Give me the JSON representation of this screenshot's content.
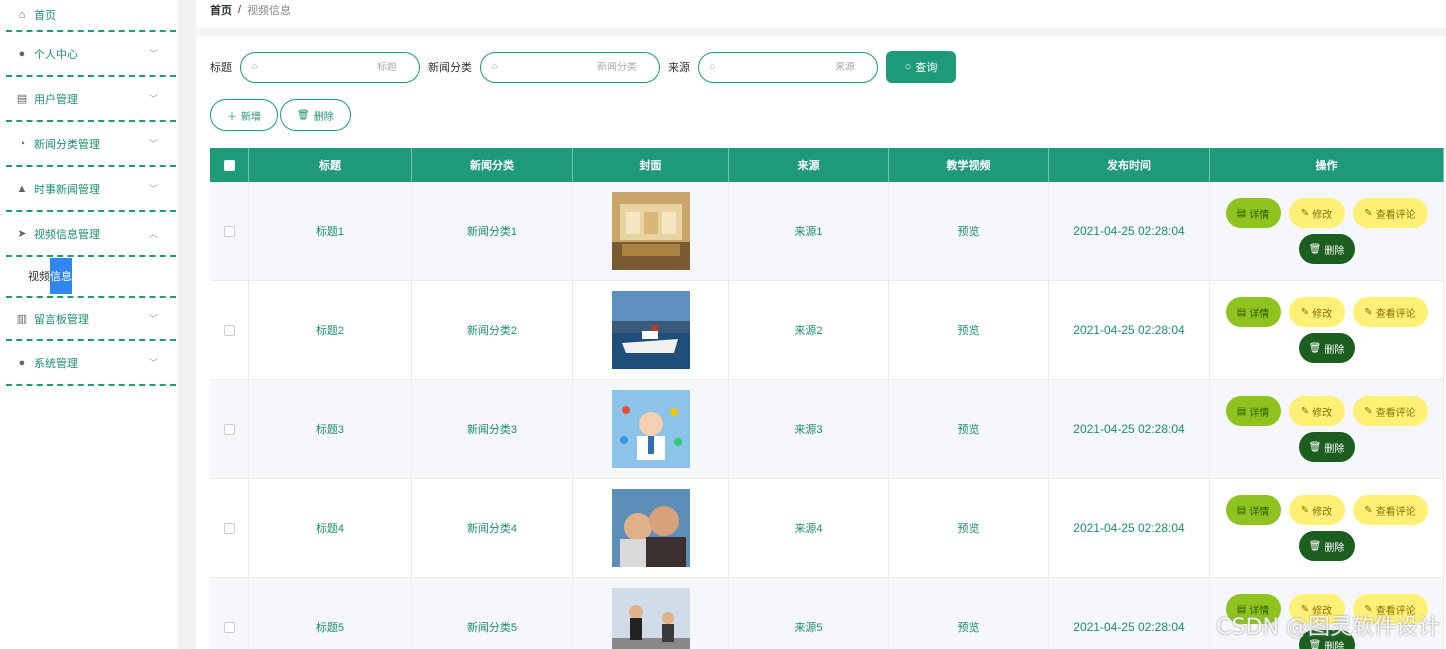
{
  "sidebar": {
    "items": [
      {
        "label": "首页",
        "icon": "home-icon"
      },
      {
        "label": "个人中心",
        "icon": "person-icon"
      },
      {
        "label": "用户管理",
        "icon": "clipboard-icon"
      },
      {
        "label": "新闻分类管理",
        "icon": "gauge-icon"
      },
      {
        "label": "时事新闻管理",
        "icon": "thumbs-up-icon"
      },
      {
        "label": "视频信息管理",
        "icon": "send-icon"
      },
      {
        "label": "留言板管理",
        "icon": "bar-chart-icon"
      },
      {
        "label": "系统管理",
        "icon": "person-icon"
      }
    ],
    "submenu": {
      "prefix": "视频",
      "highlight": "信息"
    }
  },
  "breadcrumb": {
    "home": "首页",
    "separator": "/",
    "current": "视频信息"
  },
  "search": {
    "title_label": "标题",
    "title_placeholder": "标题",
    "category_label": "新闻分类",
    "category_placeholder": "新闻分类",
    "source_label": "来源",
    "source_placeholder": "来源",
    "query_button": "查询"
  },
  "actions": {
    "add": "新增",
    "delete": "删除"
  },
  "table": {
    "headers": [
      "标题",
      "新闻分类",
      "封面",
      "来源",
      "教学视频",
      "发布时间",
      "操作"
    ],
    "rows": [
      {
        "title": "标题1",
        "category": "新闻分类1",
        "source": "来源1",
        "video": "预览",
        "time": "2021-04-25 02:28:04"
      },
      {
        "title": "标题2",
        "category": "新闻分类2",
        "source": "来源2",
        "video": "预览",
        "time": "2021-04-25 02:28:04"
      },
      {
        "title": "标题3",
        "category": "新闻分类3",
        "source": "来源3",
        "video": "预览",
        "time": "2021-04-25 02:28:04"
      },
      {
        "title": "标题4",
        "category": "新闻分类4",
        "source": "来源4",
        "video": "预览",
        "time": "2021-04-25 02:28:04"
      },
      {
        "title": "标题5",
        "category": "新闻分类5",
        "source": "来源5",
        "video": "预览",
        "time": "2021-04-25 02:28:04"
      }
    ],
    "row_actions": {
      "detail": "详情",
      "edit": "修改",
      "review": "查看评论",
      "delete": "删除"
    }
  },
  "watermark": "CSDN @图灵软件设计",
  "colors": {
    "primary": "#1e9a7a",
    "detail": "#8fc31f",
    "edit": "#fff176",
    "delete": "#1b5e20",
    "highlight": "#2f86f0"
  }
}
